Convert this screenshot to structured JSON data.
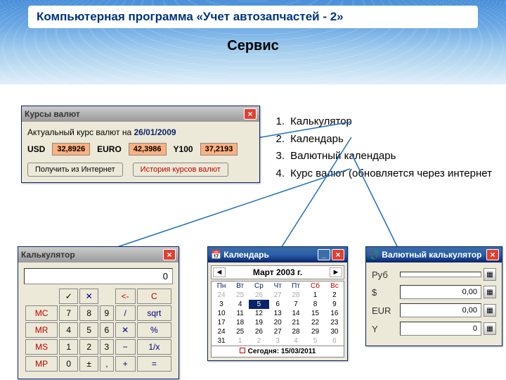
{
  "slide": {
    "title": "Компьютерная программа «Учет автозапчастей - 2»",
    "subtitle": "Сервис"
  },
  "features": [
    {
      "n": "1.",
      "t": "Калькулятор"
    },
    {
      "n": "2.",
      "t": "Календарь"
    },
    {
      "n": "3.",
      "t": "Валютный календарь"
    },
    {
      "n": "4.",
      "t": "Курс валют (обновляется через интернет"
    }
  ],
  "cur": {
    "title": "Курсы валют",
    "actual": "Актуальный курс валют на",
    "date": "26/01/2009",
    "usd_l": "USD",
    "usd": "32,8926",
    "eur_l": "EURO",
    "eur": "42,3986",
    "y_l": "Y100",
    "y": "37,2193",
    "btn_get": "Получить из Интернет",
    "btn_hist": "История курсов валют"
  },
  "calc": {
    "title": "Калькулятор",
    "display": "0",
    "keys": [
      [
        "",
        "✓",
        "✕",
        "",
        "<-",
        "C"
      ],
      [
        "MC",
        "7",
        "8",
        "9",
        "/",
        "sqrt"
      ],
      [
        "MR",
        "4",
        "5",
        "6",
        "✕",
        "%"
      ],
      [
        "MS",
        "1",
        "2",
        "3",
        "−",
        "1/x"
      ],
      [
        "MP",
        "0",
        "±",
        ",",
        "+",
        "="
      ]
    ]
  },
  "cal": {
    "title": "Календарь",
    "month": "Март 2003 г.",
    "dow": [
      "Пн",
      "Вт",
      "Ср",
      "Чт",
      "Пт",
      "Сб",
      "Вс"
    ],
    "rows": [
      [
        "24",
        "25",
        "26",
        "27",
        "28",
        "1",
        "2"
      ],
      [
        "3",
        "4",
        "5",
        "6",
        "7",
        "8",
        "9"
      ],
      [
        "10",
        "11",
        "12",
        "13",
        "14",
        "15",
        "16"
      ],
      [
        "17",
        "18",
        "19",
        "20",
        "21",
        "22",
        "23"
      ],
      [
        "24",
        "25",
        "26",
        "27",
        "28",
        "29",
        "30"
      ],
      [
        "31",
        "1",
        "2",
        "3",
        "4",
        "5",
        "6"
      ]
    ],
    "gray_first": 5,
    "gray_last": 6,
    "sel": [
      1,
      2
    ],
    "today_l": "Сегодня:",
    "today": "15/03/2011"
  },
  "cc": {
    "title": "Валютный калькулятор",
    "rows": [
      {
        "l": "Руб",
        "v": ""
      },
      {
        "l": "$",
        "v": "0,00"
      },
      {
        "l": "EUR",
        "v": "0,00"
      },
      {
        "l": "Y",
        "v": "0"
      }
    ]
  }
}
